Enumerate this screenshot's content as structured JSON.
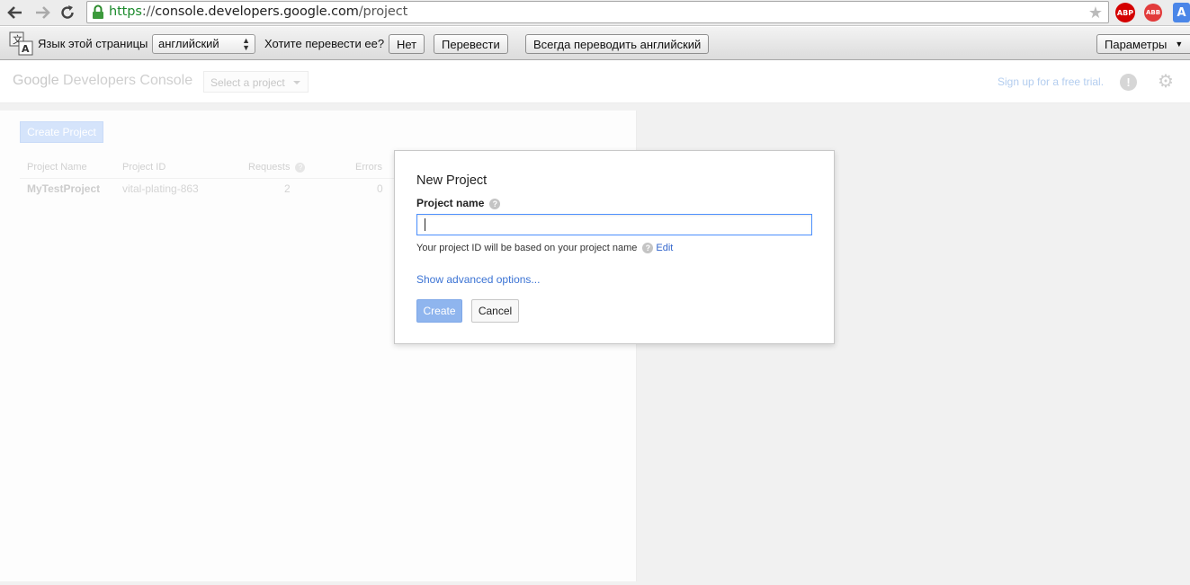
{
  "browser": {
    "url_scheme": "https",
    "url_sep": "://",
    "url_host": "console.developers.google.com",
    "url_path": "/project",
    "ext_abp": "ABP",
    "ext_abb": "ABB",
    "ext_translate": "A"
  },
  "translate_bar": {
    "page_language_label": "Язык этой страницы",
    "language_value": "английский",
    "question": "Хотите перевести ее?",
    "no_button": "Нет",
    "translate_button": "Перевести",
    "always_button": "Всегда переводить английский",
    "options_button": "Параметры"
  },
  "app": {
    "logo_google": "Google",
    "logo_product": "Developers Console",
    "project_select": "Select a project",
    "trial_link": "Sign up for a free trial.",
    "feedback_glyph": "!"
  },
  "projects": {
    "create_button": "Create Project",
    "columns": [
      "Project Name",
      "Project ID",
      "Requests",
      "Errors"
    ],
    "rows": [
      {
        "name": "MyTestProject",
        "id": "vital-plating-863",
        "requests": "2",
        "errors": "0"
      }
    ]
  },
  "dialog": {
    "title": "New Project",
    "name_label": "Project name",
    "name_value": "",
    "hint": "Your project ID will be based on your project name",
    "edit_link": "Edit",
    "advanced_link": "Show advanced options...",
    "create_button": "Create",
    "cancel_button": "Cancel"
  },
  "colors": {
    "accent_blue": "#4d90fe",
    "link_blue": "#3b73d4",
    "ssl_green": "#1a8a2b",
    "abp_red": "#d40000"
  }
}
